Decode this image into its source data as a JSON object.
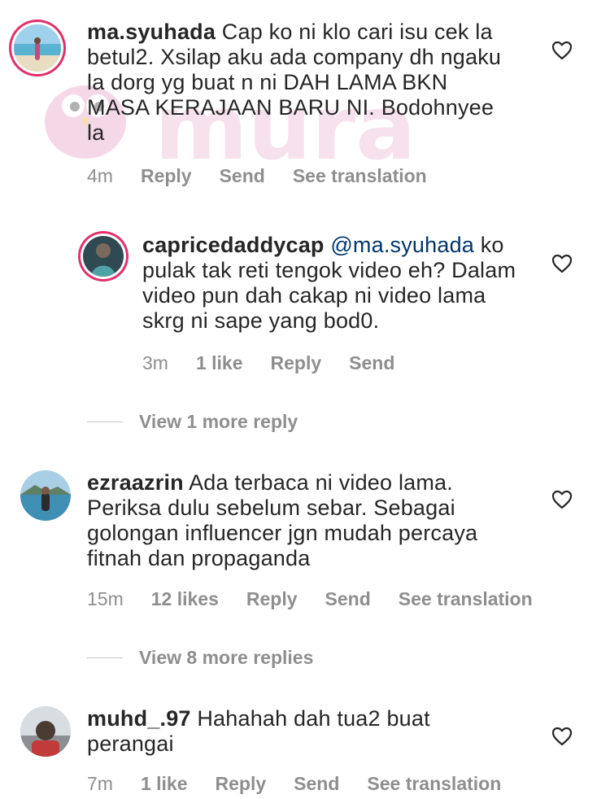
{
  "comments": [
    {
      "username": "ma.syuhada",
      "text": "Cap ko ni klo cari isu cek la betul2. Xsilap aku ada company dh ngaku la dorg yg buat n ni DAH LAMA BKN MASA KERAJAAN BARU NI. Bodohnyee la",
      "time": "4m",
      "reply_label": "Reply",
      "send_label": "Send",
      "translate_label": "See translation"
    },
    {
      "username": "capricedaddycap",
      "mention": "@ma.syuhada",
      "text": "ko pulak tak reti tengok video eh? Dalam video pun dah cakap ni video lama skrg ni sape yang bod0.",
      "time": "3m",
      "likes": "1 like",
      "reply_label": "Reply",
      "send_label": "Send"
    },
    {
      "username": "ezraazrin",
      "text": "Ada terbaca ni video lama. Periksa dulu sebelum sebar. Sebagai golongan influencer jgn mudah percaya fitnah dan propaganda",
      "time": "15m",
      "likes": "12 likes",
      "reply_label": "Reply",
      "send_label": "Send",
      "translate_label": "See translation"
    },
    {
      "username": "muhd_.97",
      "text": "Hahahah dah tua2 buat perangai",
      "time": "7m",
      "likes": "1 like",
      "reply_label": "Reply",
      "send_label": "Send",
      "translate_label": "See translation"
    }
  ],
  "view_more_1": "View 1 more reply",
  "view_more_2": "View 8 more replies",
  "watermark_text": "murai",
  "colors": {
    "text": "#262626",
    "meta": "#8e8e8e",
    "mention": "#00376b",
    "story_ring": "#e1306c",
    "watermark": "#f0c9de"
  }
}
